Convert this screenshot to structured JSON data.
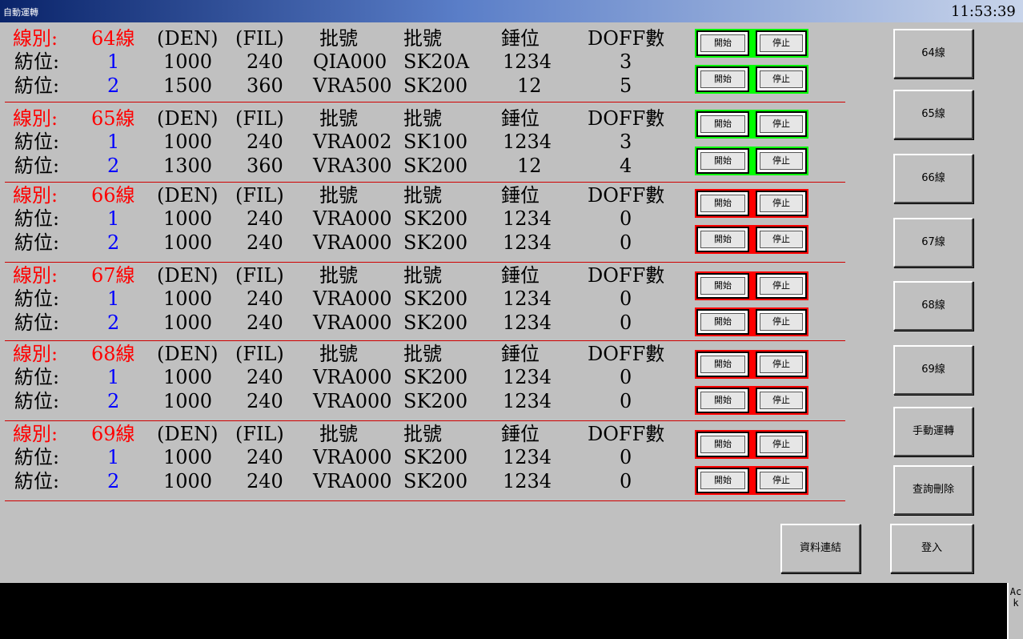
{
  "window": {
    "title": "自動運轉"
  },
  "clock": {
    "time": "11:53:39"
  },
  "labels": {
    "line_label": "線別:",
    "position_label": "紡位:",
    "den": "(DEN)",
    "fil": "(FIL)",
    "batch1": "批號",
    "batch2": "批號",
    "spindle": "錘位",
    "doff": "DOFF數",
    "start": "開始",
    "stop": "停止"
  },
  "lines": [
    {
      "name": "64線",
      "rows": [
        {
          "pos": "1",
          "den": "1000",
          "fil": "240",
          "batch1": "QIA000",
          "batch2": "SK20A",
          "spindle": "1234",
          "doff": "3",
          "status": "green"
        },
        {
          "pos": "2",
          "den": "1500",
          "fil": "360",
          "batch1": "VRA500",
          "batch2": "SK200",
          "spindle": "12",
          "doff": "5",
          "status": "green"
        }
      ]
    },
    {
      "name": "65線",
      "rows": [
        {
          "pos": "1",
          "den": "1000",
          "fil": "240",
          "batch1": "VRA002",
          "batch2": "SK100",
          "spindle": "1234",
          "doff": "3",
          "status": "green"
        },
        {
          "pos": "2",
          "den": "1300",
          "fil": "360",
          "batch1": "VRA300",
          "batch2": "SK200",
          "spindle": "12",
          "doff": "4",
          "status": "green"
        }
      ]
    },
    {
      "name": "66線",
      "rows": [
        {
          "pos": "1",
          "den": "1000",
          "fil": "240",
          "batch1": "VRA000",
          "batch2": "SK200",
          "spindle": "1234",
          "doff": "0",
          "status": "red"
        },
        {
          "pos": "2",
          "den": "1000",
          "fil": "240",
          "batch1": "VRA000",
          "batch2": "SK200",
          "spindle": "1234",
          "doff": "0",
          "status": "red"
        }
      ]
    },
    {
      "name": "67線",
      "rows": [
        {
          "pos": "1",
          "den": "1000",
          "fil": "240",
          "batch1": "VRA000",
          "batch2": "SK200",
          "spindle": "1234",
          "doff": "0",
          "status": "red"
        },
        {
          "pos": "2",
          "den": "1000",
          "fil": "240",
          "batch1": "VRA000",
          "batch2": "SK200",
          "spindle": "1234",
          "doff": "0",
          "status": "red"
        }
      ]
    },
    {
      "name": "68線",
      "rows": [
        {
          "pos": "1",
          "den": "1000",
          "fil": "240",
          "batch1": "VRA000",
          "batch2": "SK200",
          "spindle": "1234",
          "doff": "0",
          "status": "red"
        },
        {
          "pos": "2",
          "den": "1000",
          "fil": "240",
          "batch1": "VRA000",
          "batch2": "SK200",
          "spindle": "1234",
          "doff": "0",
          "status": "red"
        }
      ]
    },
    {
      "name": "69線",
      "rows": [
        {
          "pos": "1",
          "den": "1000",
          "fil": "240",
          "batch1": "VRA000",
          "batch2": "SK200",
          "spindle": "1234",
          "doff": "0",
          "status": "red"
        },
        {
          "pos": "2",
          "den": "1000",
          "fil": "240",
          "batch1": "VRA000",
          "batch2": "SK200",
          "spindle": "1234",
          "doff": "0",
          "status": "red"
        }
      ]
    }
  ],
  "side_buttons": [
    "64線",
    "65線",
    "66線",
    "67線",
    "68線",
    "69線",
    "手動運轉",
    "查詢刪除"
  ],
  "bottom_buttons": {
    "data_link": "資料連結",
    "login": "登入"
  },
  "ack": "Ack",
  "colors": {
    "green": "#00ff00",
    "red": "#ff0000",
    "header_red": "#ff0000",
    "position_blue": "#0000ff"
  }
}
